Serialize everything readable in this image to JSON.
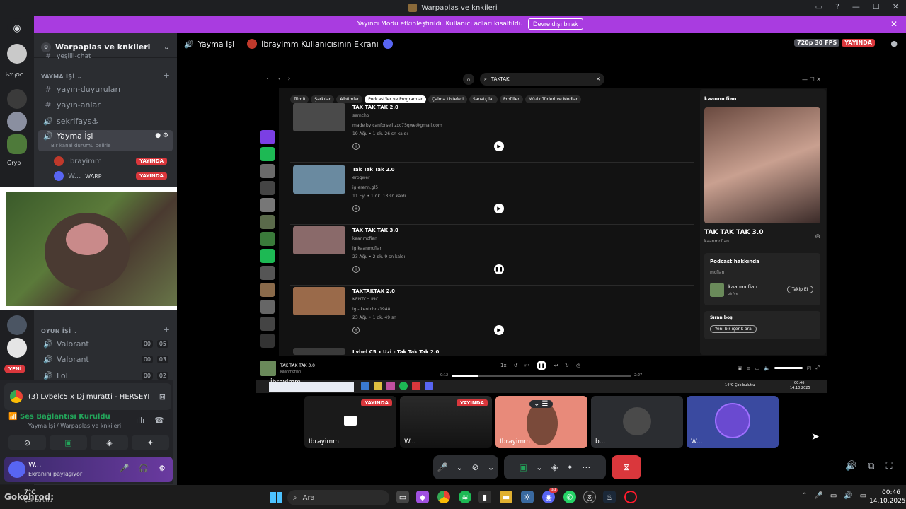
{
  "window": {
    "title": "Warpaplas ve knkileri"
  },
  "banner": {
    "text": "Yayıncı Modu etkinleştirildi. Kullanıcı adları kısaltıldı.",
    "button": "Devre dışı bırak"
  },
  "rail": {
    "labels": [
      "isYqOC",
      "Gryp",
      "YENİ"
    ]
  },
  "sidebar": {
    "server_name": "Warpaplas ve knkileri",
    "server_badge": "0",
    "top_cut": "yeşilli-chat",
    "category_yayma": "YAYMA İŞİ",
    "channels": [
      {
        "name": "yayın-duyuruları",
        "icon": "#"
      },
      {
        "name": "yayın-anlar",
        "icon": "#"
      },
      {
        "name": "sekrifays⚓",
        "icon": "🔊"
      }
    ],
    "active_voice": {
      "name": "Yayma İşi",
      "status": "Bir kanal durumu belirle"
    },
    "voice_users": [
      {
        "name": "İbrayimm",
        "badge": "YAYINDA"
      },
      {
        "name": "W...",
        "extra": "WARP",
        "badge": "YAYINDA"
      }
    ],
    "category_oyun": "OYUN İŞİ",
    "game_channels": [
      {
        "name": "Valorant",
        "a": "00",
        "b": "05"
      },
      {
        "name": "Valorant",
        "a": "00",
        "b": "03"
      },
      {
        "name": "LoL",
        "a": "00",
        "b": "02"
      }
    ]
  },
  "chrome_notice": {
    "text": "(3) Lvbelc5 x Dj muratti - HERSEYR..."
  },
  "voice_panel": {
    "status": "Ses Bağlantısı Kuruldu",
    "location": "Yayma İşi / Warpaplas ve knkileri"
  },
  "user": {
    "name": "W...",
    "status": "Ekranını paylaşıyor"
  },
  "main_header": {
    "channel": "Yayma İşi",
    "screen": "İbrayimm Kullanıcısının Ekranı",
    "quality": "720p 30 FPS",
    "live": "YAYINDA"
  },
  "spotify": {
    "search": "TAKTAK",
    "filters": [
      "Tümü",
      "Şarkılar",
      "Albümler",
      "Podcast'ler ve Programlar",
      "Çalma Listeleri",
      "Sanatçılar",
      "Profiller",
      "Müzik Türleri ve Modlar"
    ],
    "episodes": [
      {
        "title": "TAK TAK TAK 2.0",
        "sub": "semcho",
        "desc": "made by canforsell:zxc75qwe@gmail.com",
        "meta": "19 Ağu • 1 dk. 26 sn kaldı"
      },
      {
        "title": "Tak Tak Tak 2.0",
        "sub": "eroqwer",
        "desc": "ig:erenn.gl5",
        "meta": "11 Eyl • 1 dk. 13 sn kaldı"
      },
      {
        "title": "TAK TAK TAK 3.0",
        "sub": "kaanmcfian",
        "desc": "ig kaanmcfian",
        "meta": "23 Ağu • 2 dk. 9 sn kaldı"
      },
      {
        "title": "TAKTAKTAK 2.0",
        "sub": "KENTCH INC.",
        "desc": "ig - kentchcz1948",
        "meta": "23 Ağu • 1 dk. 49 sn"
      },
      {
        "title": "Lvbel C5 x Uzi - Tak Tak Tak 2.0",
        "sub": "",
        "desc": "",
        "meta": ""
      }
    ],
    "right": {
      "user": "kaanmcfian",
      "title": "TAK TAK TAK 3.0",
      "artist": "kaanmcfian",
      "about": "Podcast hakkında",
      "about_text": "mcfian",
      "follow_name": "kaanmcfian",
      "follow_sub": "zir/ve",
      "follow_btn": "Takip Et",
      "queue": "Sıran boş",
      "queue_btn": "Yeni bir içerik ara"
    },
    "player": {
      "title": "TAK TAK TAK 3.0",
      "artist": "kaanmcfian",
      "elapsed": "0:12",
      "total": "2:27",
      "speed": "1x",
      "progress": 0.15
    },
    "inner_task": {
      "weather": "14°C Çok bulutlu",
      "time": "00:46",
      "date": "14.10.2025"
    },
    "overlay_name": "İbrayimm"
  },
  "tiles": [
    {
      "name": "İbrayimm",
      "live": "YAYINDA"
    },
    {
      "name": "W...",
      "live": "YAYINDA"
    },
    {
      "name": "İbrayimm",
      "live": ""
    },
    {
      "name": "b...",
      "live": ""
    },
    {
      "name": "W...",
      "live": ""
    }
  ],
  "taskbar": {
    "weather": "7°C",
    "weather_sub": "Çok bulutlu",
    "overlay": "Gokohrod:",
    "search": "Ara",
    "time": "00:46",
    "date": "14.10.2025",
    "badge": "99"
  }
}
